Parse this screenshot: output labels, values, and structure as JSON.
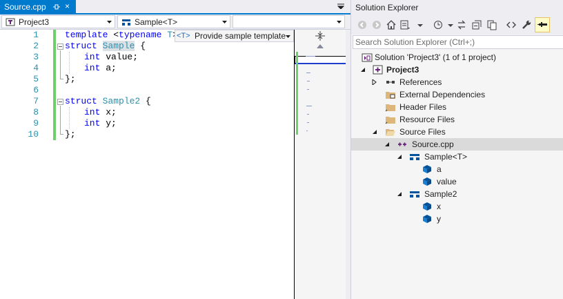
{
  "editor": {
    "tab": {
      "title": "Source.cpp",
      "close": "×"
    },
    "nav": {
      "project": "Project3",
      "scope": "Sample<T>",
      "member": ""
    },
    "template_bar": {
      "badge": "<T>",
      "label": "Provide sample template"
    },
    "line_numbers": [
      "1",
      "2",
      "3",
      "4",
      "5",
      "6",
      "7",
      "8",
      "9",
      "10"
    ],
    "code": {
      "l1_kw1": "template",
      "l1_mid": " <",
      "l1_kw2": "typename",
      "l1_ty": " T",
      "l1_end": ">",
      "l2_kw": "struct",
      "l2_name": "Sample",
      "l2_end": " {",
      "l3_kw": "int",
      "l3_rest": " value;",
      "l4_kw": "int",
      "l4_rest": " a;",
      "l5": "};",
      "l7_kw": "struct",
      "l7_name": "Sample2",
      "l7_end": " {",
      "l8_kw": "int",
      "l8_rest": " x;",
      "l9_kw": "int",
      "l9_rest": " y;",
      "l10": "};"
    }
  },
  "solution_explorer": {
    "title": "Solution Explorer",
    "search_placeholder": "Search Solution Explorer (Ctrl+;)",
    "tree": {
      "solution": "Solution 'Project3' (1 of 1 project)",
      "project": "Project3",
      "references": "References",
      "external_dependencies": "External Dependencies",
      "header_files": "Header Files",
      "resource_files": "Resource Files",
      "source_files": "Source Files",
      "source_cpp": "Source.cpp",
      "sample_t": "Sample<T>",
      "member_a": "a",
      "member_value": "value",
      "sample2": "Sample2",
      "member_x": "x",
      "member_y": "y"
    }
  },
  "colors": {
    "accent": "#007acc",
    "keyword": "#0000ff",
    "type": "#2b91af",
    "change_bar": "#6cd16c"
  }
}
